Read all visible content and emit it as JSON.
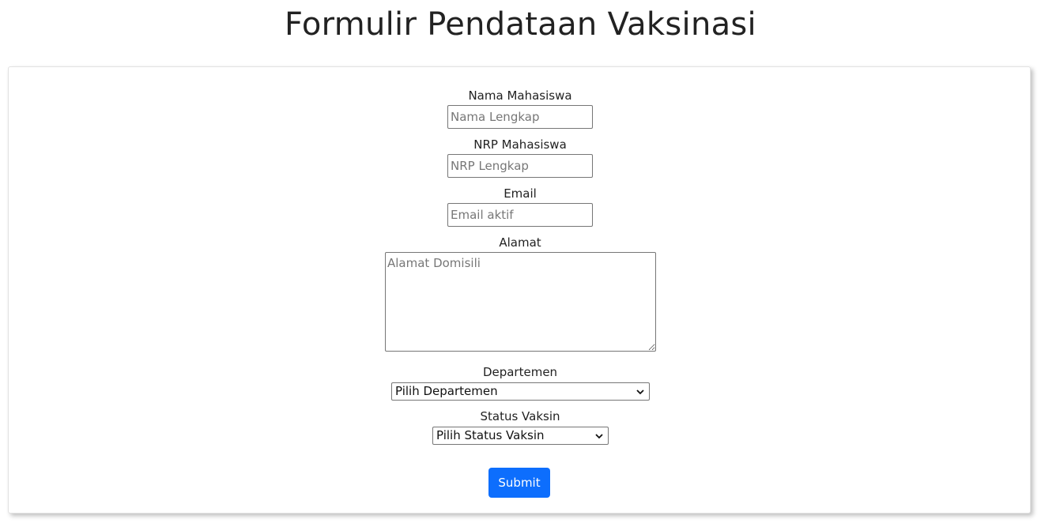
{
  "page": {
    "title": "Formulir Pendataan Vaksinasi"
  },
  "form": {
    "name_label": "Nama Mahasiswa",
    "name_placeholder": "Nama Lengkap",
    "nrp_label": "NRP Mahasiswa",
    "nrp_placeholder": "NRP Lengkap",
    "email_label": "Email",
    "email_placeholder": "Email aktif",
    "address_label": "Alamat",
    "address_placeholder": "Alamat Domisili",
    "department_label": "Departemen",
    "department_selected": "Pilih Departemen",
    "vaccine_label": "Status Vaksin",
    "vaccine_selected": "Pilih Status Vaksin",
    "submit_label": "Submit"
  },
  "colors": {
    "accent": "#0d6efd",
    "text": "#222222",
    "placeholder": "#777777"
  },
  "icons": {
    "select_arrow": "chevron-down-icon"
  }
}
